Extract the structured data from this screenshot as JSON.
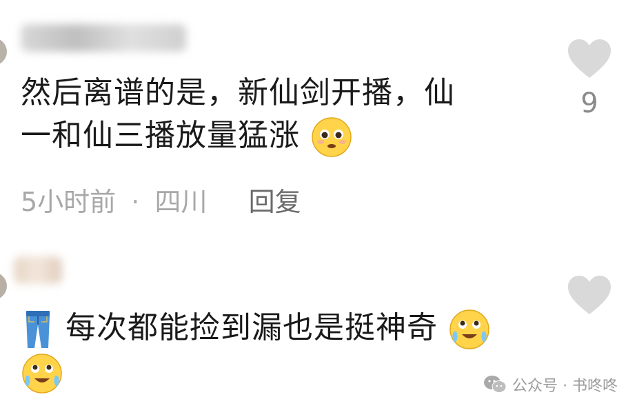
{
  "comments": [
    {
      "text_line1": "然后离谱的是，新仙剑开播，仙",
      "text_line2": "一和仙三播放量猛涨",
      "time": "5小时前",
      "separator": "·",
      "location": "四川",
      "reply_label": "回复",
      "likes": "9",
      "emoji": "pleading-face-icon"
    },
    {
      "text": "每次都能捡到漏也是挺神奇",
      "prefix_emoji": "jeans-icon",
      "suffix_emoji": "laughing-tears-face-icon",
      "trailing_emoji": "laughing-tears-face-icon"
    }
  ],
  "watermark": {
    "text": "公众号 · 书咚咚",
    "icon": "wechat-icon"
  },
  "colors": {
    "text": "#1a1a1a",
    "meta": "#a8a8a8",
    "heart": "#d9d9d9",
    "emoji_yellow": "#ffd44a"
  }
}
